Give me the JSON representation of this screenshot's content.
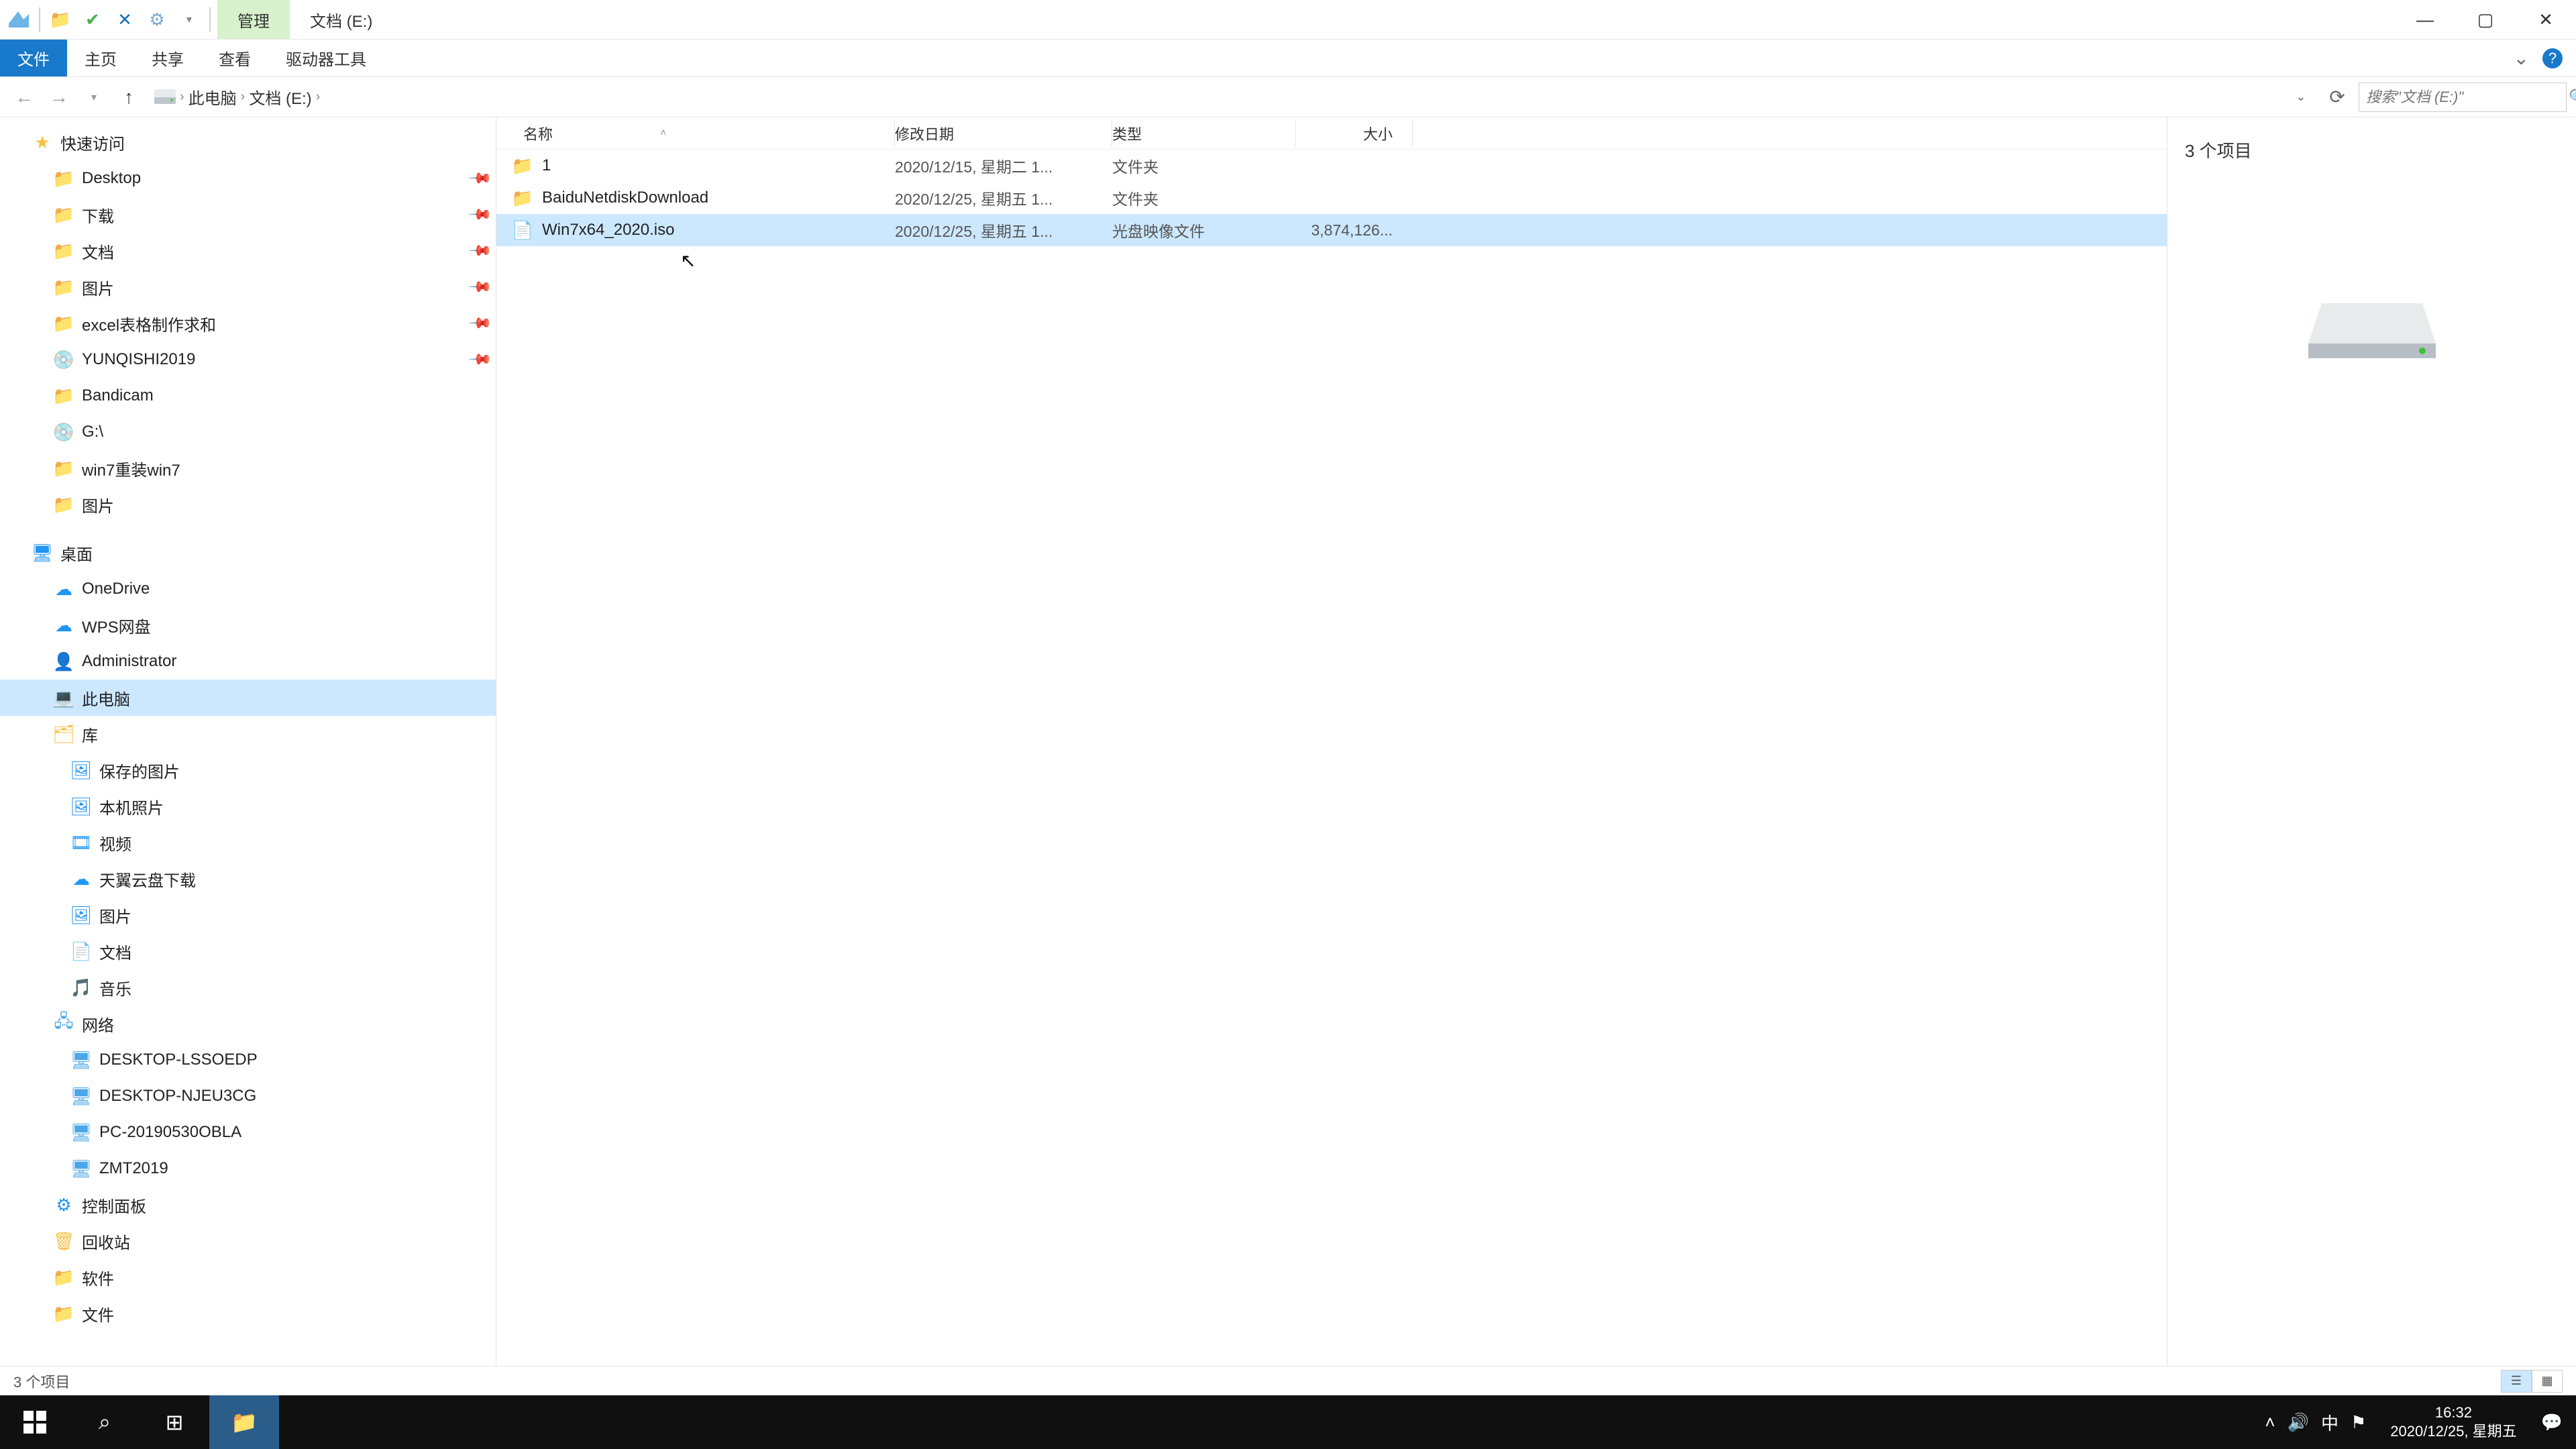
{
  "titlebar": {
    "manage_tab": "管理",
    "title": "文档 (E:)"
  },
  "ribbon": {
    "file": "文件",
    "home": "主页",
    "share": "共享",
    "view": "查看",
    "drive_tools": "驱动器工具"
  },
  "breadcrumb": {
    "pc": "此电脑",
    "drive": "文档 (E:)"
  },
  "search": {
    "placeholder": "搜索\"文档 (E:)\""
  },
  "columns": {
    "name": "名称",
    "date": "修改日期",
    "type": "类型",
    "size": "大小"
  },
  "files": [
    {
      "name": "1",
      "date": "2020/12/15, 星期二 1...",
      "type": "文件夹",
      "size": "",
      "icon": "folder",
      "selected": false
    },
    {
      "name": "BaiduNetdiskDownload",
      "date": "2020/12/25, 星期五 1...",
      "type": "文件夹",
      "size": "",
      "icon": "folder",
      "selected": false
    },
    {
      "name": "Win7x64_2020.iso",
      "date": "2020/12/25, 星期五 1...",
      "type": "光盘映像文件",
      "size": "3,874,126...",
      "icon": "iso",
      "selected": true
    }
  ],
  "preview": {
    "count_label": "3 个项目"
  },
  "statusbar": {
    "text": "3 个项目"
  },
  "sidebar": [
    {
      "label": "快速访问",
      "icon": "star",
      "indent": 0,
      "pinned": false
    },
    {
      "label": "Desktop",
      "icon": "folder-b",
      "indent": 1,
      "pinned": true
    },
    {
      "label": "下载",
      "icon": "folder-b",
      "indent": 1,
      "pinned": true
    },
    {
      "label": "文档",
      "icon": "folder-b",
      "indent": 1,
      "pinned": true
    },
    {
      "label": "图片",
      "icon": "folder-b",
      "indent": 1,
      "pinned": true
    },
    {
      "label": "excel表格制作求和",
      "icon": "folder",
      "indent": 1,
      "pinned": true
    },
    {
      "label": "YUNQISHI2019",
      "icon": "disc",
      "indent": 1,
      "pinned": true
    },
    {
      "label": "Bandicam",
      "icon": "folder",
      "indent": 1,
      "pinned": false
    },
    {
      "label": "G:\\",
      "icon": "disc",
      "indent": 1,
      "pinned": false
    },
    {
      "label": "win7重装win7",
      "icon": "folder",
      "indent": 1,
      "pinned": false
    },
    {
      "label": "图片",
      "icon": "folder",
      "indent": 1,
      "pinned": false
    },
    {
      "gap": true
    },
    {
      "label": "桌面",
      "icon": "desktop",
      "indent": 0,
      "pinned": false
    },
    {
      "label": "OneDrive",
      "icon": "cloud",
      "indent": 1,
      "pinned": false
    },
    {
      "label": "WPS网盘",
      "icon": "cloud-w",
      "indent": 1,
      "pinned": false
    },
    {
      "label": "Administrator",
      "icon": "user",
      "indent": 1,
      "pinned": false
    },
    {
      "label": "此电脑",
      "icon": "pc",
      "indent": 1,
      "pinned": false,
      "selected": true
    },
    {
      "label": "库",
      "icon": "lib",
      "indent": 1,
      "pinned": false
    },
    {
      "label": "保存的图片",
      "icon": "pic",
      "indent": 2,
      "pinned": false
    },
    {
      "label": "本机照片",
      "icon": "pic",
      "indent": 2,
      "pinned": false
    },
    {
      "label": "视频",
      "icon": "vid",
      "indent": 2,
      "pinned": false
    },
    {
      "label": "天翼云盘下载",
      "icon": "cloud",
      "indent": 2,
      "pinned": false
    },
    {
      "label": "图片",
      "icon": "pic",
      "indent": 2,
      "pinned": false
    },
    {
      "label": "文档",
      "icon": "doc",
      "indent": 2,
      "pinned": false
    },
    {
      "label": "音乐",
      "icon": "music",
      "indent": 2,
      "pinned": false
    },
    {
      "label": "网络",
      "icon": "net",
      "indent": 1,
      "pinned": false
    },
    {
      "label": "DESKTOP-LSSOEDP",
      "icon": "netpc",
      "indent": 2,
      "pinned": false
    },
    {
      "label": "DESKTOP-NJEU3CG",
      "icon": "netpc",
      "indent": 2,
      "pinned": false
    },
    {
      "label": "PC-20190530OBLA",
      "icon": "netpc",
      "indent": 2,
      "pinned": false
    },
    {
      "label": "ZMT2019",
      "icon": "netpc",
      "indent": 2,
      "pinned": false
    },
    {
      "label": "控制面板",
      "icon": "cpl",
      "indent": 1,
      "pinned": false
    },
    {
      "label": "回收站",
      "icon": "bin",
      "indent": 1,
      "pinned": false
    },
    {
      "label": "软件",
      "icon": "folder",
      "indent": 1,
      "pinned": false
    },
    {
      "label": "文件",
      "icon": "folder",
      "indent": 1,
      "pinned": false
    }
  ],
  "taskbar": {
    "time": "16:32",
    "date": "2020/12/25, 星期五",
    "ime": "中"
  }
}
